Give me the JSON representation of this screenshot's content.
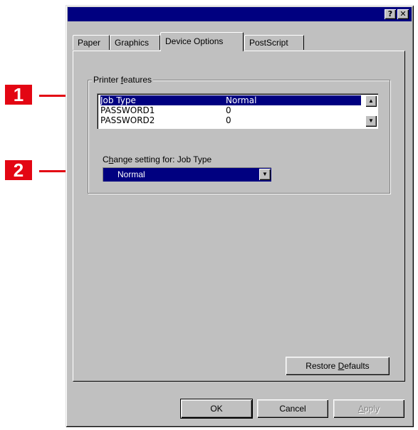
{
  "callouts": [
    "1",
    "2"
  ],
  "titlebar": {
    "help_glyph": "?",
    "close_glyph": "✕"
  },
  "tabs": [
    {
      "label": "Paper"
    },
    {
      "label": "Graphics"
    },
    {
      "label": "Device Options"
    },
    {
      "label": "PostScript"
    }
  ],
  "active_tab": "Device Options",
  "printer_features": {
    "legend_prefix": "Printer ",
    "legend_accel": "f",
    "legend_suffix": "eatures",
    "rows": [
      {
        "name": "Job Type",
        "value": "Normal",
        "selected": true
      },
      {
        "name": "PASSWORD1",
        "value": "0",
        "selected": false
      },
      {
        "name": "PASSWORD2",
        "value": "0",
        "selected": false
      }
    ],
    "scroll_up_glyph": "▲",
    "scroll_down_glyph": "▼"
  },
  "change_setting": {
    "label_prefix": "C",
    "label_accel": "h",
    "label_suffix": "ange setting for:  Job Type",
    "current_value": "Normal",
    "dropdown_glyph": "▼"
  },
  "restore_defaults": {
    "prefix": "Restore ",
    "accel": "D",
    "suffix": "efaults"
  },
  "footer": {
    "ok_label": "OK",
    "cancel_label": "Cancel",
    "apply_accel": "A",
    "apply_suffix": "pply"
  },
  "colors": {
    "titlebar": "#000080",
    "dialog_face": "#c0c0c0",
    "selection": "#000080",
    "callout": "#e30613"
  }
}
